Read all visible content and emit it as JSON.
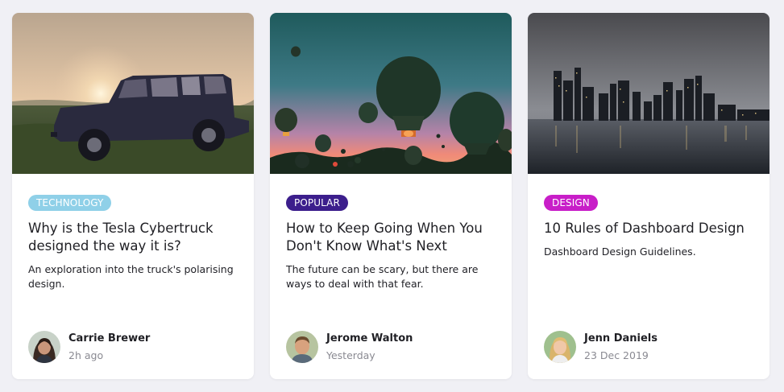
{
  "cards": [
    {
      "image": "jeep-sunset-photo",
      "tag": {
        "label": "TECHNOLOGY",
        "color": "#8fd0e8"
      },
      "title": "Why is the Tesla Cybertruck designed the way it is?",
      "description": "An exploration into the truck's polarising design.",
      "author": {
        "name": "Carrie Brewer",
        "time": "2h ago"
      }
    },
    {
      "image": "hot-air-balloons-photo",
      "tag": {
        "label": "POPULAR",
        "color": "#3c1e8c"
      },
      "title": "How to Keep Going When You Don't Know What's Next",
      "description": "The future can be scary, but there are ways to deal with that fear.",
      "author": {
        "name": "Jerome Walton",
        "time": "Yesterday"
      }
    },
    {
      "image": "city-skyline-night-photo",
      "tag": {
        "label": "DESIGN",
        "color": "#c81ec8"
      },
      "title": "10 Rules of Dashboard Design",
      "description": "Dashboard Design Guidelines.",
      "author": {
        "name": "Jenn Daniels",
        "time": "23 Dec 2019"
      }
    }
  ]
}
